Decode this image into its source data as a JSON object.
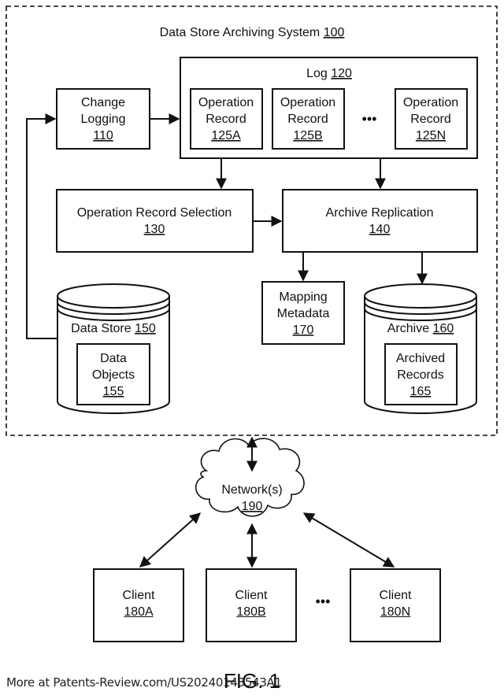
{
  "system": {
    "title": "Data Store Archiving System",
    "ref": "100"
  },
  "change_logging": {
    "line1": "Change",
    "line2": "Logging",
    "ref": "110"
  },
  "log": {
    "title": "Log",
    "ref": "120",
    "records": [
      {
        "line1": "Operation",
        "line2": "Record",
        "ref": "125A"
      },
      {
        "line1": "Operation",
        "line2": "Record",
        "ref": "125B"
      },
      {
        "line1": "Operation",
        "line2": "Record",
        "ref": "125N"
      }
    ],
    "ellipsis": "•••"
  },
  "selection": {
    "title": "Operation Record Selection",
    "ref": "130"
  },
  "replication": {
    "title": "Archive Replication",
    "ref": "140"
  },
  "mapping": {
    "line1": "Mapping",
    "line2": "Metadata",
    "ref": "170"
  },
  "data_store": {
    "title": "Data Store",
    "ref": "150",
    "inner": {
      "line1": "Data",
      "line2": "Objects",
      "ref": "155"
    }
  },
  "archive": {
    "title": "Archive",
    "ref": "160",
    "inner": {
      "line1": "Archived",
      "line2": "Records",
      "ref": "165"
    }
  },
  "network": {
    "title": "Network(s)",
    "ref": "190"
  },
  "clients": [
    {
      "label": "Client",
      "ref": "180A"
    },
    {
      "label": "Client",
      "ref": "180B"
    },
    {
      "label": "Client",
      "ref": "180N"
    }
  ],
  "clients_ellipsis": "•••",
  "figure_label": "FIG. 1",
  "footer": "More at Patents-Review.com/US20240143543A1"
}
